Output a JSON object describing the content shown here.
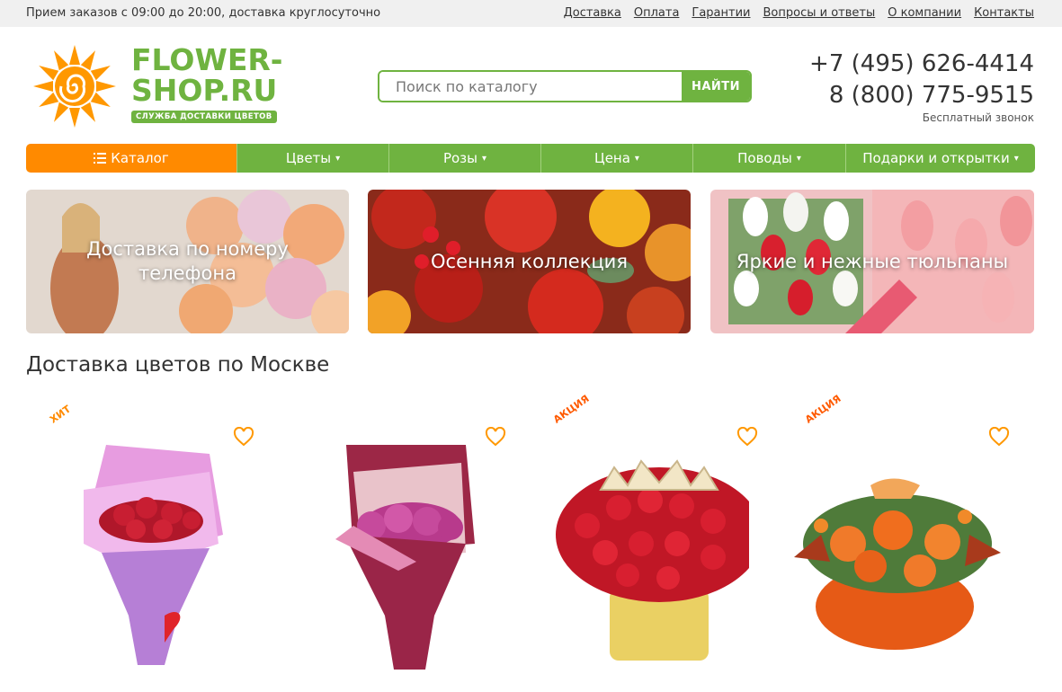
{
  "topbar": {
    "info": "Прием заказов с 09:00 до 20:00, доставка круглосуточно",
    "links": [
      "Доставка",
      "Оплата",
      "Гарантии",
      "Вопросы и ответы",
      "О компании",
      "Контакты"
    ]
  },
  "logo": {
    "line1": "FLOWER-",
    "line2": "SHOP.RU",
    "tagline": "СЛУЖБА ДОСТАВКИ ЦВЕТОВ"
  },
  "search": {
    "placeholder": "Поиск по каталогу",
    "value": "",
    "button": "НАЙТИ"
  },
  "phones": {
    "phone1": "+7 (495) 626-4414",
    "phone2": "8 (800) 775-9515",
    "note": "Бесплатный звонок"
  },
  "nav": {
    "catalog": "Каталог",
    "items": [
      "Цветы",
      "Розы",
      "Цена",
      "Поводы",
      "Подарки и открытки"
    ]
  },
  "banners": [
    "Доставка по номеру телефона",
    "Осенняя коллекция",
    "Яркие и нежные тюльпаны"
  ],
  "section_title": "Доставка цветов по Москве",
  "products": [
    {
      "badge": "ХИТ"
    },
    {
      "badge": ""
    },
    {
      "badge": "АКЦИЯ"
    },
    {
      "badge": "АКЦИЯ"
    }
  ],
  "colors": {
    "green": "#6fb340",
    "orange": "#ff8a00",
    "badge_red": "#ff5a00"
  }
}
